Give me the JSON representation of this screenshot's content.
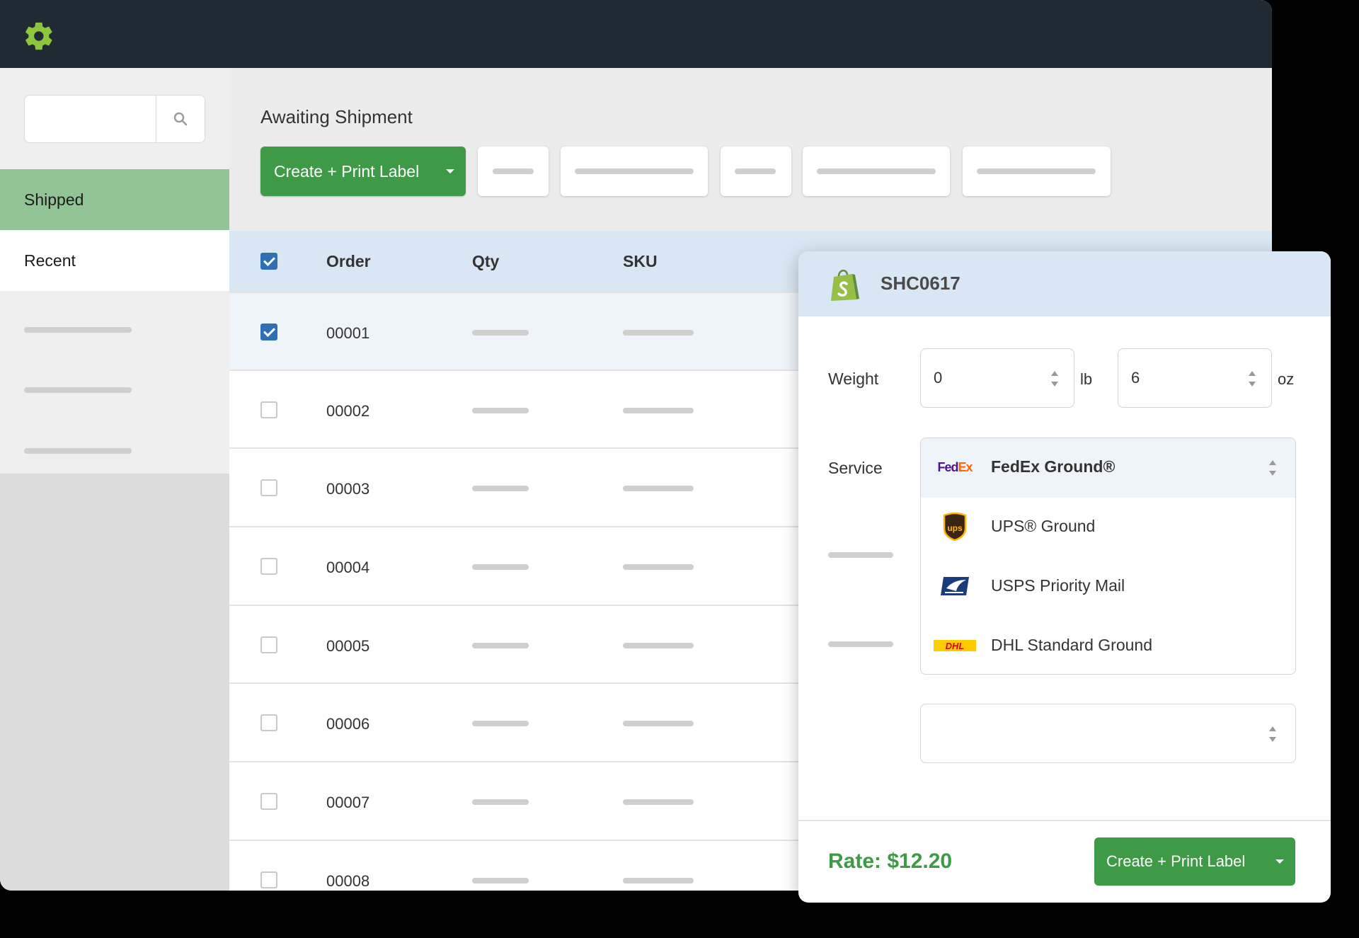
{
  "topbar": {
    "logo_icon": "gear-icon"
  },
  "sidebar": {
    "search": {
      "value": "",
      "icon": "search-icon"
    },
    "items": [
      {
        "label": "Shipped",
        "active": true
      },
      {
        "label": "Recent"
      }
    ]
  },
  "main": {
    "title": "Awaiting Shipment",
    "toolbar": {
      "create_label": "Create + Print Label"
    },
    "table": {
      "headers": {
        "order": "Order",
        "qty": "Qty",
        "sku": "SKU"
      },
      "rows": [
        {
          "order": "00001",
          "checked": true
        },
        {
          "order": "00002",
          "checked": false
        },
        {
          "order": "00003",
          "checked": false
        },
        {
          "order": "00004",
          "checked": false
        },
        {
          "order": "00005",
          "checked": false
        },
        {
          "order": "00006",
          "checked": false
        },
        {
          "order": "00007",
          "checked": false
        },
        {
          "order": "00008",
          "checked": false
        }
      ]
    }
  },
  "panel": {
    "store_icon": "shopify-bag-icon",
    "title": "SHC0617",
    "weight": {
      "label": "Weight",
      "lb_value": "0",
      "lb_unit": "lb",
      "oz_value": "6",
      "oz_unit": "oz"
    },
    "service": {
      "label": "Service",
      "options": [
        {
          "label": "FedEx Ground®",
          "icon": "fedex-logo",
          "logo_text": "FedEx",
          "selected": true
        },
        {
          "label": "UPS® Ground",
          "icon": "ups-logo",
          "logo_text": "ups"
        },
        {
          "label": "USPS Priority Mail",
          "icon": "usps-logo"
        },
        {
          "label": "DHL Standard Ground",
          "icon": "dhl-logo",
          "logo_text": "DHL"
        }
      ]
    },
    "rate": "Rate: $12.20",
    "create_label": "Create + Print Label"
  },
  "colors": {
    "accent": "#3e9a47",
    "topbar": "#1f2a33",
    "header": "#d9e6f3",
    "checkbox": "#2f6fb3"
  }
}
